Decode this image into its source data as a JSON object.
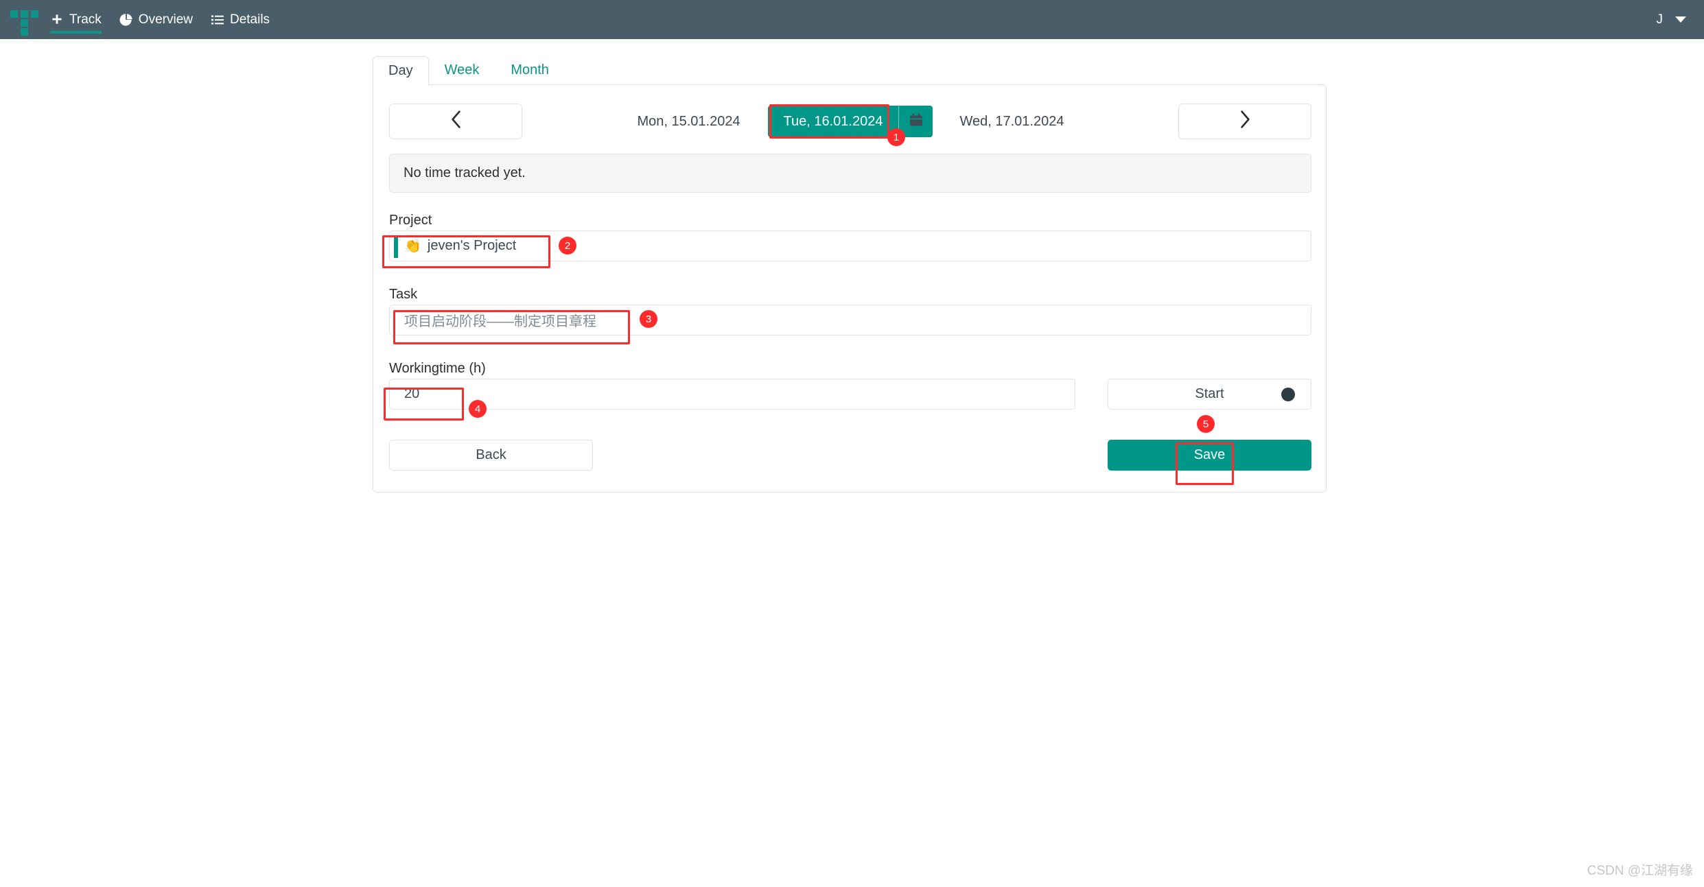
{
  "navbar": {
    "logo_name": "timetracker-logo",
    "items": [
      {
        "label": "Track",
        "icon": "plus-icon",
        "active": true
      },
      {
        "label": "Overview",
        "icon": "pie-chart-icon",
        "active": false
      },
      {
        "label": "Details",
        "icon": "list-icon",
        "active": false
      }
    ],
    "user": {
      "initial": "J",
      "caret": "chevron-down-icon"
    },
    "background_color": "#4a5e6a",
    "accent_color": "#0c9488"
  },
  "tabs": [
    {
      "label": "Day",
      "active": true
    },
    {
      "label": "Week",
      "active": false
    },
    {
      "label": "Month",
      "active": false
    }
  ],
  "date_nav": {
    "prev_icon": "chevron-left-icon",
    "next_icon": "chevron-right-icon",
    "prev_date": "Mon, 15.01.2024",
    "current_date": "Tue, 16.01.2024",
    "next_date": "Wed, 17.01.2024",
    "calendar_icon": "calendar-icon",
    "active_color": "#009688"
  },
  "alert": {
    "message": "No time tracked yet."
  },
  "form": {
    "project": {
      "label": "Project",
      "emoji": "👏",
      "value": "jeven's Project"
    },
    "task": {
      "label": "Task",
      "value": "项目启动阶段——制定项目章程"
    },
    "workingtime": {
      "label": "Workingtime (h)",
      "value": "20"
    },
    "start_button": {
      "label": "Start",
      "icon": "record-dot-icon"
    },
    "back_button": {
      "label": "Back"
    },
    "save_button": {
      "label": "Save"
    }
  },
  "annotations": [
    {
      "id": "1"
    },
    {
      "id": "2"
    },
    {
      "id": "3"
    },
    {
      "id": "4"
    },
    {
      "id": "5"
    }
  ],
  "watermark": {
    "text": "CSDN @江湖有缘"
  }
}
